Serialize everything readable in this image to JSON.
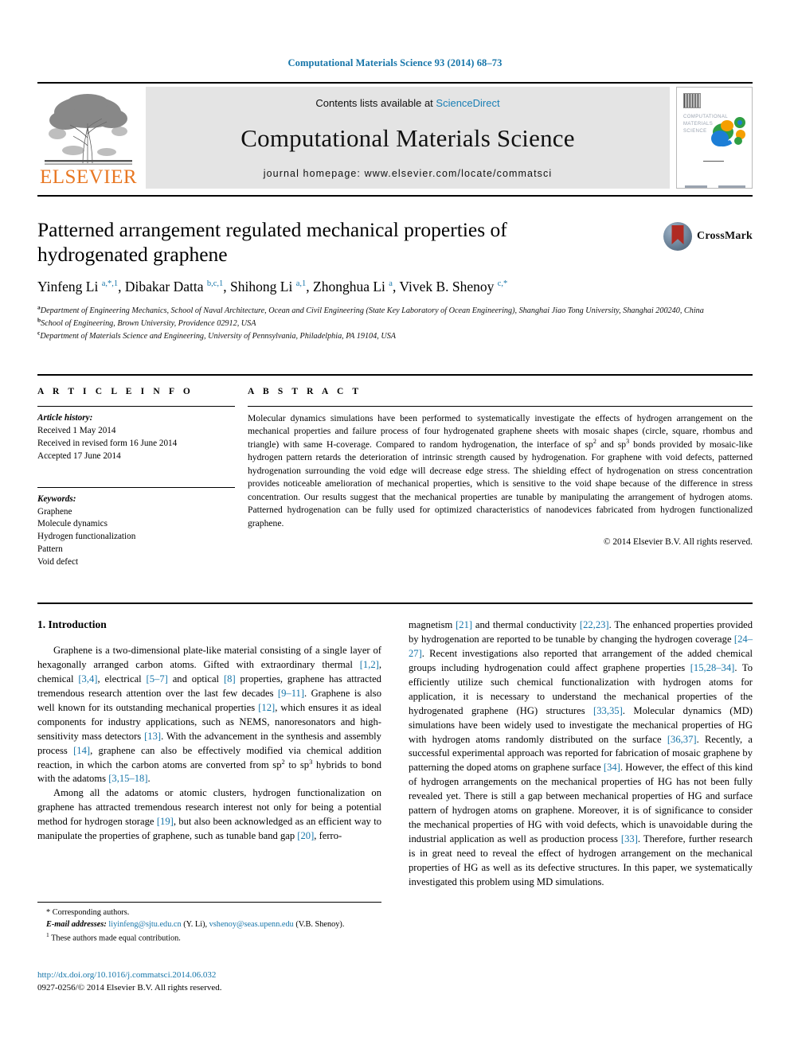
{
  "running_head": "Computational Materials Science 93 (2014) 68–73",
  "masthead": {
    "contents_prefix": "Contents lists available at ",
    "sciencedirect": "ScienceDirect",
    "journal_title": "Computational Materials Science",
    "homepage": "journal homepage: www.elsevier.com/locate/commatsci",
    "publisher_logo_text": "ELSEVIER",
    "cover_title_lines": "COMPUTATIONAL\nMATERIALS\nSCIENCE",
    "accent_blue": "#1675a9",
    "elsevier_orange": "#E87722"
  },
  "article": {
    "title": "Patterned arrangement regulated mechanical properties of hydrogenated graphene",
    "crossmark_label": "CrossMark",
    "authors_html": "Yinfeng Li <sup>a,*,1</sup>, Dibakar Datta <sup>b,c,1</sup>, Shihong Li <sup>a,1</sup>, Zhonghua Li <sup>a</sup>, Vivek B. Shenoy <sup>c,*</sup>",
    "affiliations": [
      "a Department of Engineering Mechanics, School of Naval Architecture, Ocean and Civil Engineering (State Key Laboratory of Ocean Engineering), Shanghai Jiao Tong University, Shanghai 200240, China",
      "b School of Engineering, Brown University, Providence 02912, USA",
      "c Department of Materials Science and Engineering, University of Pennsylvania, Philadelphia, PA 19104, USA"
    ]
  },
  "article_info": {
    "heading": "A R T I C L E   I N F O",
    "history_label": "Article history:",
    "history": [
      "Received 1 May 2014",
      "Received in revised form 16 June 2014",
      "Accepted 17 June 2014"
    ],
    "keywords_label": "Keywords:",
    "keywords": [
      "Graphene",
      "Molecule dynamics",
      "Hydrogen functionalization",
      "Pattern",
      "Void defect"
    ]
  },
  "abstract": {
    "heading": "A B S T R A C T",
    "text": "Molecular dynamics simulations have been performed to systematically investigate the effects of hydrogen arrangement on the mechanical properties and failure process of four hydrogenated graphene sheets with mosaic shapes (circle, square, rhombus and triangle) with same H-coverage. Compared to random hydrogenation, the interface of sp2 and sp3 bonds provided by mosaic-like hydrogen pattern retards the deterioration of intrinsic strength caused by hydrogenation. For graphene with void defects, patterned hydrogenation surrounding the void edge will decrease edge stress. The shielding effect of hydrogenation on stress concentration provides noticeable amelioration of mechanical properties, which is sensitive to the void shape because of the difference in stress concentration. Our results suggest that the mechanical properties are tunable by manipulating the arrangement of hydrogen atoms. Patterned hydrogenation can be fully used for optimized characteristics of nanodevices fabricated from hydrogen functionalized graphene.",
    "copyright": "© 2014 Elsevier B.V. All rights reserved."
  },
  "introduction": {
    "section_title": "1. Introduction",
    "left_paragraph_1_parts": [
      {
        "t": "Graphene is a two-dimensional plate-like material consisting of a single layer of hexagonally arranged carbon atoms. Gifted with extraordinary thermal "
      },
      {
        "t": "[1,2]",
        "ref": true
      },
      {
        "t": ", chemical "
      },
      {
        "t": "[3,4]",
        "ref": true
      },
      {
        "t": ", electrical "
      },
      {
        "t": "[5–7]",
        "ref": true
      },
      {
        "t": " and optical "
      },
      {
        "t": "[8]",
        "ref": true
      },
      {
        "t": " properties, graphene has attracted tremendous research attention over the last few decades "
      },
      {
        "t": "[9–11]",
        "ref": true
      },
      {
        "t": ". Graphene is also well known for its outstanding mechanical properties "
      },
      {
        "t": "[12]",
        "ref": true
      },
      {
        "t": ", which ensures it as ideal components for industry applications, such as NEMS, nanoresonators and high-sensitivity mass detectors "
      },
      {
        "t": "[13]",
        "ref": true
      },
      {
        "t": ". With the advancement in the synthesis and assembly process "
      },
      {
        "t": "[14]",
        "ref": true
      },
      {
        "t": ", graphene can also be effectively modified via chemical addition reaction, in which the carbon atoms are converted from sp2 to sp3 hybrids to bond with the adatoms "
      },
      {
        "t": "[3,15–18]",
        "ref": true
      },
      {
        "t": "."
      }
    ],
    "left_paragraph_2_parts": [
      {
        "t": "Among all the adatoms or atomic clusters, hydrogen functionalization on graphene has attracted tremendous research interest not only for being a potential method for hydrogen storage "
      },
      {
        "t": "[19]",
        "ref": true
      },
      {
        "t": ", but also been acknowledged as an efficient way to manipulate the properties of graphene, such as tunable band gap "
      },
      {
        "t": "[20]",
        "ref": true
      },
      {
        "t": ", ferro-"
      }
    ],
    "right_paragraph_parts": [
      {
        "t": "magnetism "
      },
      {
        "t": "[21]",
        "ref": true
      },
      {
        "t": " and thermal conductivity "
      },
      {
        "t": "[22,23]",
        "ref": true
      },
      {
        "t": ". The enhanced properties provided by hydrogenation are reported to be tunable by changing the hydrogen coverage "
      },
      {
        "t": "[24–27]",
        "ref": true
      },
      {
        "t": ". Recent investigations also reported that arrangement of the added chemical groups including hydrogenation could affect graphene properties "
      },
      {
        "t": "[15,28–34]",
        "ref": true
      },
      {
        "t": ". To efficiently utilize such chemical functionalization with hydrogen atoms for application, it is necessary to understand the mechanical properties of the hydrogenated graphene (HG) structures "
      },
      {
        "t": "[33,35]",
        "ref": true
      },
      {
        "t": ". Molecular dynamics (MD) simulations have been widely used to investigate the mechanical properties of HG with hydrogen atoms randomly distributed on the surface "
      },
      {
        "t": "[36,37]",
        "ref": true
      },
      {
        "t": ". Recently, a successful experimental approach was reported for fabrication of mosaic graphene by patterning the doped atoms on graphene surface "
      },
      {
        "t": "[34]",
        "ref": true
      },
      {
        "t": ". However, the effect of this kind of hydrogen arrangements on the mechanical properties of HG has not been fully revealed yet. There is still a gap between mechanical properties of HG and surface pattern of hydrogen atoms on graphene. Moreover, it is of significance to consider the mechanical properties of HG with void defects, which is unavoidable during the industrial application as well as production process "
      },
      {
        "t": "[33]",
        "ref": true
      },
      {
        "t": ". Therefore, further research is in great need to reveal the effect of hydrogen arrangement on the mechanical properties of HG as well as its defective structures. In this paper, we systematically investigated this problem using MD simulations."
      }
    ]
  },
  "footnotes": {
    "corresponding": "* Corresponding authors.",
    "email_label": "E-mail addresses:",
    "email_1": "liyinfeng@sjtu.edu.cn",
    "email_1_owner": "(Y. Li),",
    "email_2": "vshenoy@seas.upenn.edu",
    "email_2_owner": "(V.B. Shenoy).",
    "equal_contribution": "These authors made equal contribution.",
    "equal_contribution_marker": "1"
  },
  "footer": {
    "doi": "http://dx.doi.org/10.1016/j.commatsci.2014.06.032",
    "issn_line": "0927-0256/© 2014 Elsevier B.V. All rights reserved."
  }
}
